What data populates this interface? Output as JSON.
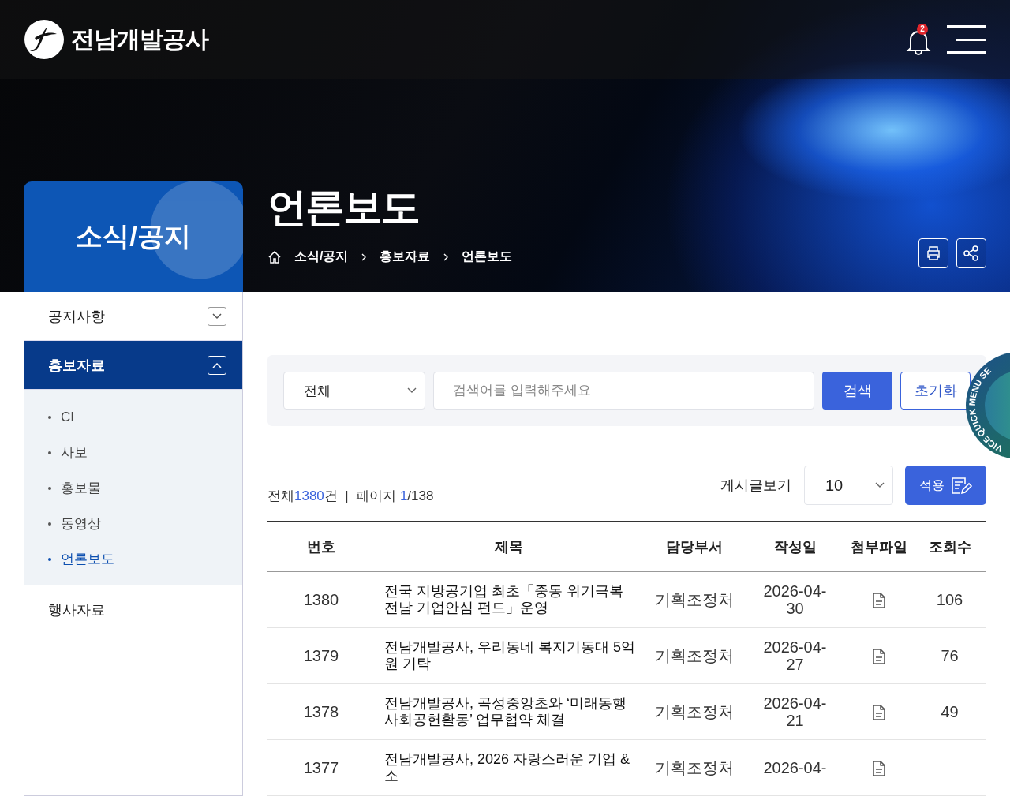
{
  "header": {
    "logo_text": "전남개발공사",
    "notification_count": "2"
  },
  "hero": {
    "section_title": "소식/공지",
    "page_title": "언론보도",
    "breadcrumb": [
      "소식/공지",
      "홍보자료",
      "언론보도"
    ]
  },
  "sidebar": {
    "items": [
      {
        "label": "공지사항",
        "selected": false,
        "expanded": false
      },
      {
        "label": "홍보자료",
        "selected": true,
        "expanded": true,
        "children": [
          {
            "label": "CI",
            "selected": false
          },
          {
            "label": "사보",
            "selected": false
          },
          {
            "label": "홍보물",
            "selected": false
          },
          {
            "label": "동영상",
            "selected": false
          },
          {
            "label": "언론보도",
            "selected": true
          }
        ]
      },
      {
        "label": "행사자료",
        "selected": false
      }
    ]
  },
  "search": {
    "category": "전체",
    "placeholder": "검색어를 입력해주세요",
    "search_button": "검색",
    "reset_button": "초기화"
  },
  "summary": {
    "total_label": "전체",
    "total": "1380",
    "total_unit": "건",
    "separator": "|",
    "page_label": "페이지",
    "page": "1",
    "page_total": "/138"
  },
  "page_size": {
    "label": "게시글보기",
    "value": "10",
    "apply_button": "적용"
  },
  "table": {
    "columns": [
      "번호",
      "제목",
      "담당부서",
      "작성일",
      "첨부파일",
      "조회수"
    ],
    "rows": [
      {
        "number": "1380",
        "title": "전국 지방공기업 최초「중동 위기극복 전남 기업안심 펀드」운영",
        "department": "기획조정처",
        "date": "2026-04-30",
        "attachment": true,
        "views": "106"
      },
      {
        "number": "1379",
        "title": "전남개발공사, 우리동네 복지기동대 5억원 기탁",
        "department": "기획조정처",
        "date": "2026-04-27",
        "attachment": true,
        "views": "76"
      },
      {
        "number": "1378",
        "title": "전남개발공사, 곡성중앙초와 ‘미래동행 사회공헌활동’ 업무협약 체결",
        "department": "기획조정처",
        "date": "2026-04-21",
        "attachment": true,
        "views": "49"
      },
      {
        "number": "1377",
        "title": "전남개발공사, 2026 자랑스러운 기업 & 소",
        "department": "기획조정처",
        "date": "2026-04-",
        "attachment": true
      }
    ]
  },
  "quick_menu": {
    "top_text": "QUICK MENU SE",
    "bottom_text": "VICE"
  }
}
